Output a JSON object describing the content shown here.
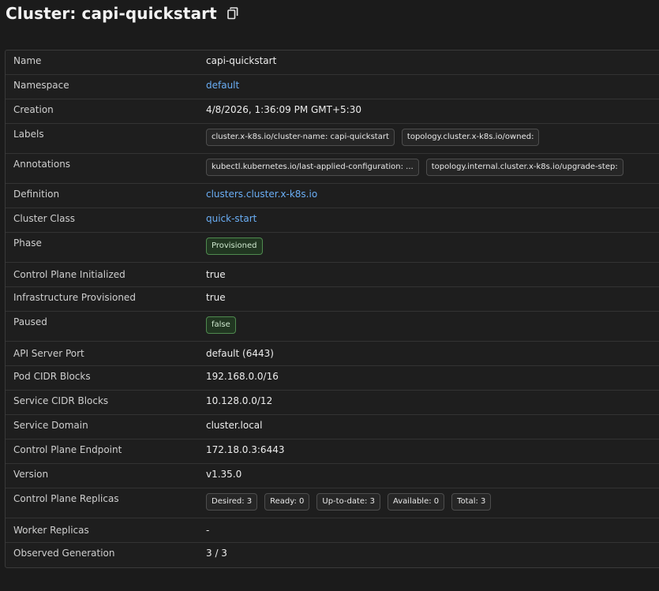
{
  "page": {
    "title": "Cluster: capi-quickstart",
    "copy_icon": "copy-icon"
  },
  "details": {
    "name": {
      "label": "Name",
      "value": "capi-quickstart"
    },
    "namespace": {
      "label": "Namespace",
      "value": "default"
    },
    "creation": {
      "label": "Creation",
      "value": "4/8/2026, 1:36:09 PM GMT+5:30"
    },
    "labels": {
      "label": "Labels",
      "items": [
        "cluster.x-k8s.io/cluster-name: capi-quickstart",
        "topology.cluster.x-k8s.io/owned:"
      ]
    },
    "annotations": {
      "label": "Annotations",
      "items": [
        "kubectl.kubernetes.io/last-applied-configuration: ...",
        "topology.internal.cluster.x-k8s.io/upgrade-step:"
      ]
    },
    "definition": {
      "label": "Definition",
      "value": "clusters.cluster.x-k8s.io"
    },
    "cluster_class": {
      "label": "Cluster Class",
      "value": "quick-start"
    },
    "phase": {
      "label": "Phase",
      "value": "Provisioned"
    },
    "control_plane_initialized": {
      "label": "Control Plane Initialized",
      "value": "true"
    },
    "infrastructure_provisioned": {
      "label": "Infrastructure Provisioned",
      "value": "true"
    },
    "paused": {
      "label": "Paused",
      "value": "false"
    },
    "api_server_port": {
      "label": "API Server Port",
      "value": "default (6443)"
    },
    "pod_cidr": {
      "label": "Pod CIDR Blocks",
      "value": "192.168.0.0/16"
    },
    "service_cidr": {
      "label": "Service CIDR Blocks",
      "value": "10.128.0.0/12"
    },
    "service_domain": {
      "label": "Service Domain",
      "value": "cluster.local"
    },
    "control_plane_endpoint": {
      "label": "Control Plane Endpoint",
      "value": "172.18.0.3:6443"
    },
    "version": {
      "label": "Version",
      "value": "v1.35.0"
    },
    "control_plane_replicas": {
      "label": "Control Plane Replicas",
      "items": [
        "Desired: 3",
        "Ready: 0",
        "Up-to-date: 3",
        "Available: 0",
        "Total: 3"
      ]
    },
    "worker_replicas": {
      "label": "Worker Replicas",
      "value": "-"
    },
    "observed_generation": {
      "label": "Observed Generation",
      "value": "3 / 3"
    }
  },
  "colors": {
    "background": "#1b1b1b",
    "link": "#6aaef5",
    "success_chip_bg": "#213621",
    "success_chip_border": "#4f8a4f"
  }
}
